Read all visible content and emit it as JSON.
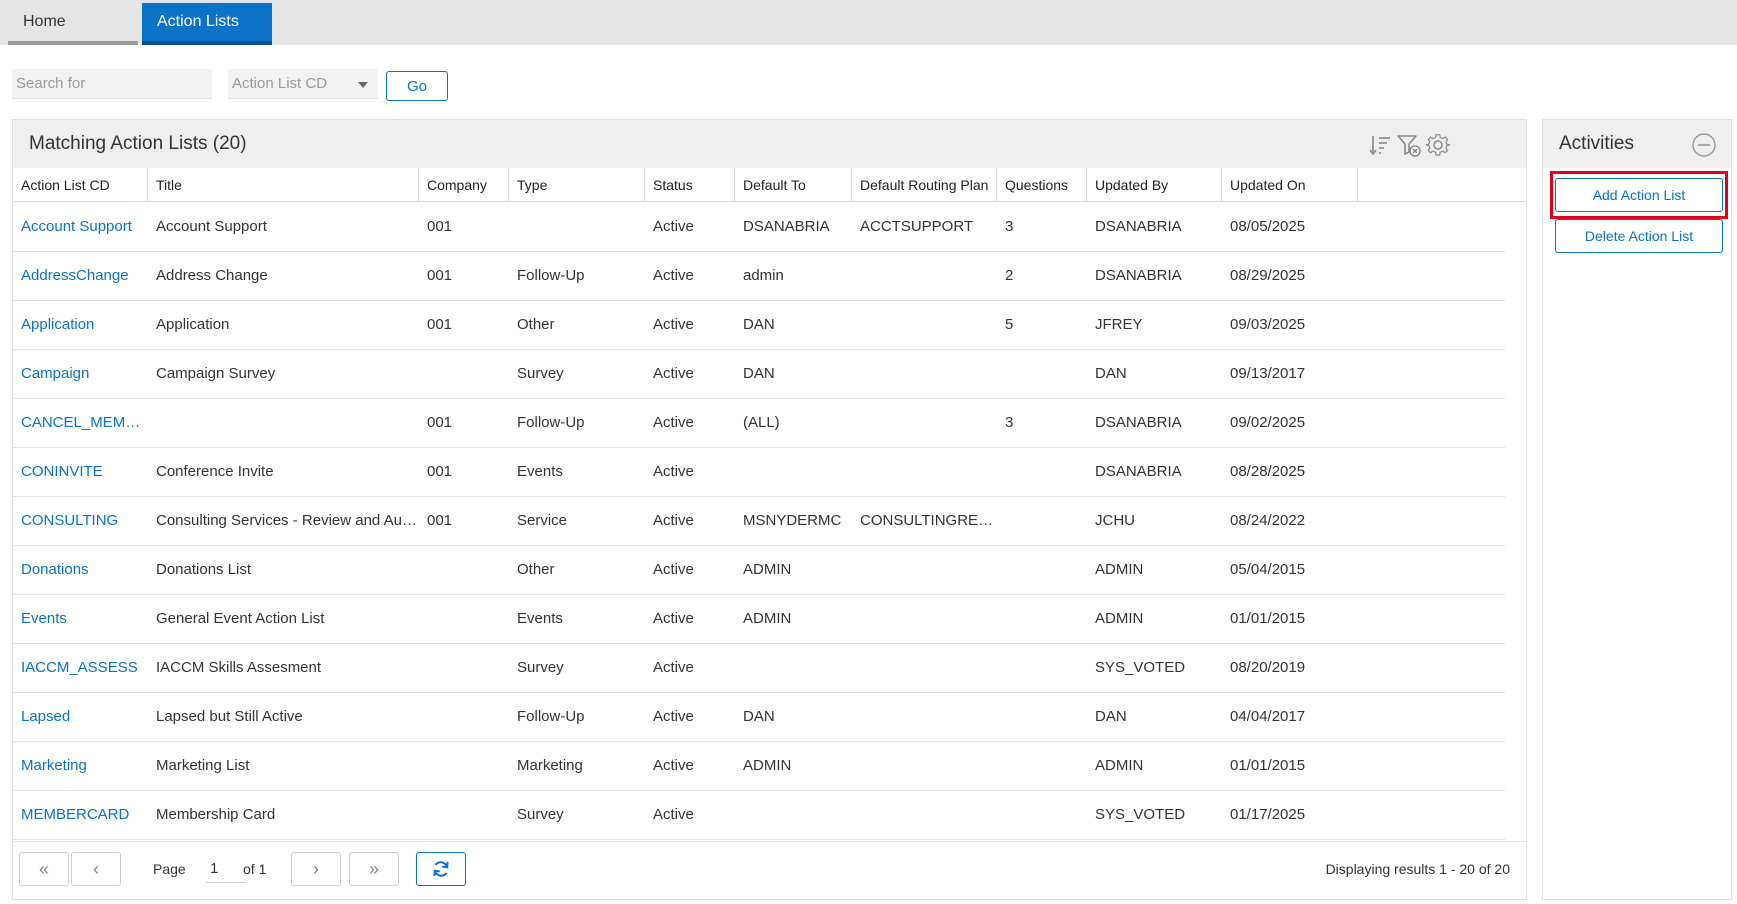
{
  "tabs": [
    {
      "label": "Home"
    },
    {
      "label": "Action Lists"
    }
  ],
  "search": {
    "placeholder": "Search for",
    "field_select": "Action List CD",
    "go_label": "Go"
  },
  "grid": {
    "title": "Matching Action Lists (20)",
    "columns": [
      "Action List CD",
      "Title",
      "Company",
      "Type",
      "Status",
      "Default To",
      "Default Routing Plan",
      "Questions",
      "Updated By",
      "Updated On"
    ],
    "rows": [
      {
        "cd": "Account Support",
        "title": "Account Support",
        "company": "001",
        "type": "",
        "status": "Active",
        "default_to": "DSANABRIA",
        "routing": "ACCTSUPPORT",
        "questions": "3",
        "updated_by": "DSANABRIA",
        "updated_on": "08/05/2025"
      },
      {
        "cd": "AddressChange",
        "title": "Address Change",
        "company": "001",
        "type": "Follow-Up",
        "status": "Active",
        "default_to": "admin",
        "routing": "",
        "questions": "2",
        "updated_by": "DSANABRIA",
        "updated_on": "08/29/2025"
      },
      {
        "cd": "Application",
        "title": "Application",
        "company": "001",
        "type": "Other",
        "status": "Active",
        "default_to": "DAN",
        "routing": "",
        "questions": "5",
        "updated_by": "JFREY",
        "updated_on": "09/03/2025"
      },
      {
        "cd": "Campaign",
        "title": "Campaign Survey",
        "company": "",
        "type": "Survey",
        "status": "Active",
        "default_to": "DAN",
        "routing": "",
        "questions": "",
        "updated_by": "DAN",
        "updated_on": "09/13/2017"
      },
      {
        "cd": "CANCEL_MEMBE...",
        "title": "",
        "company": "001",
        "type": "Follow-Up",
        "status": "Active",
        "default_to": "(ALL)",
        "routing": "",
        "questions": "3",
        "updated_by": "DSANABRIA",
        "updated_on": "09/02/2025"
      },
      {
        "cd": "CONINVITE",
        "title": "Conference Invite",
        "company": "001",
        "type": "Events",
        "status": "Active",
        "default_to": "",
        "routing": "",
        "questions": "",
        "updated_by": "DSANABRIA",
        "updated_on": "08/28/2025"
      },
      {
        "cd": "CONSULTING",
        "title": "Consulting Services - Review and Audits",
        "company": "001",
        "type": "Service",
        "status": "Active",
        "default_to": "MSNYDERMC",
        "routing": "CONSULTINGREVIEW",
        "questions": "",
        "updated_by": "JCHU",
        "updated_on": "08/24/2022"
      },
      {
        "cd": "Donations",
        "title": "Donations List",
        "company": "",
        "type": "Other",
        "status": "Active",
        "default_to": "ADMIN",
        "routing": "",
        "questions": "",
        "updated_by": "ADMIN",
        "updated_on": "05/04/2015"
      },
      {
        "cd": "Events",
        "title": "General Event Action List",
        "company": "",
        "type": "Events",
        "status": "Active",
        "default_to": "ADMIN",
        "routing": "",
        "questions": "",
        "updated_by": "ADMIN",
        "updated_on": "01/01/2015"
      },
      {
        "cd": "IACCM_ASSESS",
        "title": "IACCM Skills Assesment",
        "company": "",
        "type": "Survey",
        "status": "Active",
        "default_to": "",
        "routing": "",
        "questions": "",
        "updated_by": "SYS_VOTED",
        "updated_on": "08/20/2019"
      },
      {
        "cd": "Lapsed",
        "title": "Lapsed but Still Active",
        "company": "",
        "type": "Follow-Up",
        "status": "Active",
        "default_to": "DAN",
        "routing": "",
        "questions": "",
        "updated_by": "DAN",
        "updated_on": "04/04/2017"
      },
      {
        "cd": "Marketing",
        "title": "Marketing List",
        "company": "",
        "type": "Marketing",
        "status": "Active",
        "default_to": "ADMIN",
        "routing": "",
        "questions": "",
        "updated_by": "ADMIN",
        "updated_on": "01/01/2015"
      },
      {
        "cd": "MEMBERCARD",
        "title": "Membership Card",
        "company": "",
        "type": "Survey",
        "status": "Active",
        "default_to": "",
        "routing": "",
        "questions": "",
        "updated_by": "SYS_VOTED",
        "updated_on": "01/17/2025"
      }
    ]
  },
  "pager": {
    "page_label": "Page",
    "page_value": "1",
    "of_label": "of 1",
    "info": "Displaying results 1 - 20 of 20"
  },
  "activities": {
    "title": "Activities",
    "add_label": "Add Action List",
    "delete_label": "Delete Action List"
  },
  "colors": {
    "accent": "#0a73c7",
    "highlight": "#e0001b"
  },
  "icons": {
    "sort": "sort-icon",
    "filter_clear": "filter-clear-icon",
    "settings": "gear-icon",
    "collapse": "minus-circle-icon",
    "first": "first-page-icon",
    "prev": "prev-page-icon",
    "next": "next-page-icon",
    "last": "last-page-icon",
    "refresh": "refresh-icon"
  }
}
